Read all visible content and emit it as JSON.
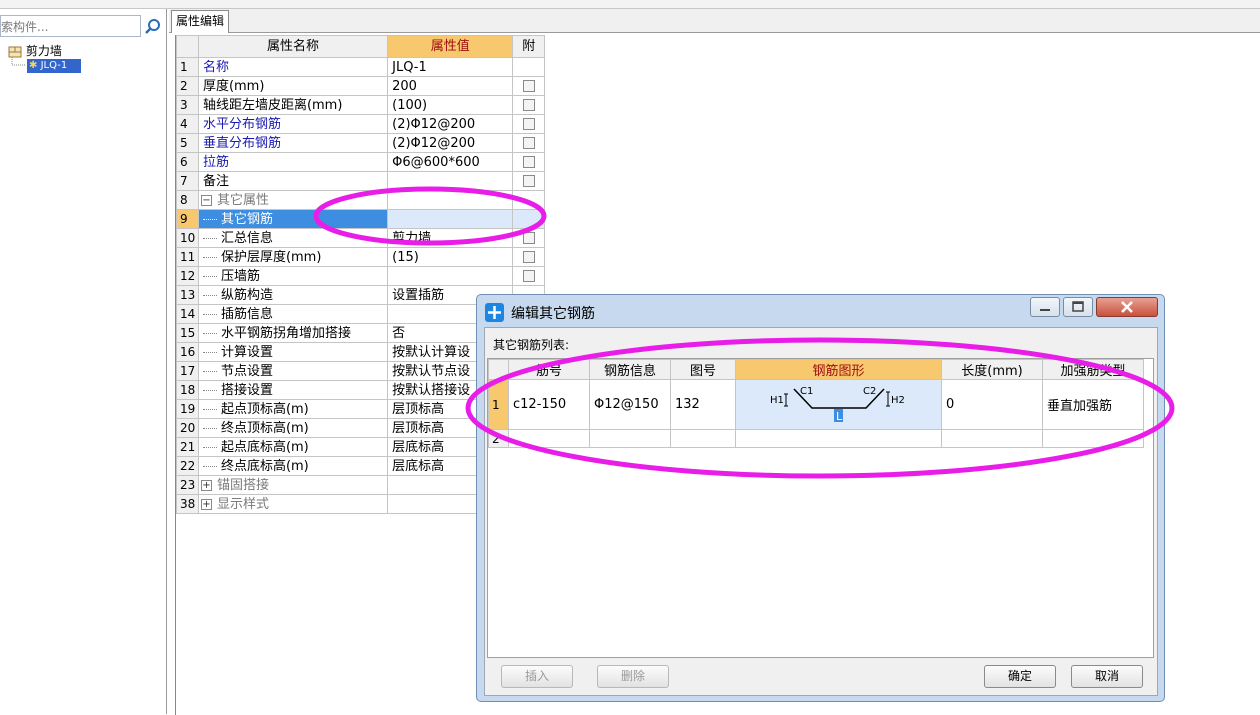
{
  "left_panel": {
    "search_text": "索构件...",
    "tree_root": "剪力墙",
    "tree_child": "JLQ-1"
  },
  "tab": {
    "label": "属性编辑"
  },
  "property_table": {
    "headers": {
      "name": "属性名称",
      "value": "属性值",
      "attached": "附"
    },
    "rows": [
      {
        "num": "1",
        "name": "名称",
        "value": "JLQ-1"
      },
      {
        "num": "2",
        "name": "厚度(mm)",
        "value": "200"
      },
      {
        "num": "3",
        "name": "轴线距左墙皮距离(mm)",
        "value": "(100)"
      },
      {
        "num": "4",
        "name": "水平分布钢筋",
        "value": "(2)Φ12@200"
      },
      {
        "num": "5",
        "name": "垂直分布钢筋",
        "value": "(2)Φ12@200"
      },
      {
        "num": "6",
        "name": "拉筋",
        "value": "Φ6@600*600"
      },
      {
        "num": "7",
        "name": "备注",
        "value": ""
      },
      {
        "num": "8",
        "name": "其它属性",
        "value": ""
      },
      {
        "num": "9",
        "name": "其它钢筋",
        "value": ""
      },
      {
        "num": "10",
        "name": "汇总信息",
        "value": "剪力墙"
      },
      {
        "num": "11",
        "name": "保护层厚度(mm)",
        "value": "(15)"
      },
      {
        "num": "12",
        "name": "压墙筋",
        "value": ""
      },
      {
        "num": "13",
        "name": "纵筋构造",
        "value": "设置插筋"
      },
      {
        "num": "14",
        "name": "插筋信息",
        "value": ""
      },
      {
        "num": "15",
        "name": "水平钢筋拐角增加搭接",
        "value": "否"
      },
      {
        "num": "16",
        "name": "计算设置",
        "value": "按默认计算设"
      },
      {
        "num": "17",
        "name": "节点设置",
        "value": "按默认节点设"
      },
      {
        "num": "18",
        "name": "搭接设置",
        "value": "按默认搭接设"
      },
      {
        "num": "19",
        "name": "起点顶标高(m)",
        "value": "层顶标高"
      },
      {
        "num": "20",
        "name": "终点顶标高(m)",
        "value": "层顶标高"
      },
      {
        "num": "21",
        "name": "起点底标高(m)",
        "value": "层底标高"
      },
      {
        "num": "22",
        "name": "终点底标高(m)",
        "value": "层底标高"
      },
      {
        "num": "23",
        "name": "锚固搭接",
        "value": ""
      },
      {
        "num": "38",
        "name": "显示样式",
        "value": ""
      }
    ]
  },
  "dialog": {
    "title": "编辑其它钢筋",
    "list_label": "其它钢筋列表:",
    "headers": {
      "num": "",
      "bar_no": "筋号",
      "bar_info": "钢筋信息",
      "shape_no": "图号",
      "shape": "钢筋图形",
      "length": "长度(mm)",
      "type": "加强筋类型"
    },
    "rows": [
      {
        "num": "1",
        "bar_no": "c12-150",
        "bar_info": "Φ12@150",
        "shape_no": "132",
        "length": "0",
        "type": "垂直加强筋"
      },
      {
        "num": "2",
        "bar_no": "",
        "bar_info": "",
        "shape_no": "",
        "length": "",
        "type": ""
      }
    ],
    "shape_labels": {
      "h1": "H1",
      "c1": "C1",
      "c2": "C2",
      "h2": "H2",
      "l": "L"
    },
    "buttons": {
      "insert": "插入",
      "delete": "删除",
      "ok": "确定",
      "cancel": "取消"
    }
  },
  "colors": {
    "highlight": "#e81ee8",
    "header_selected": "#f7c86d",
    "row_selected": "#3d8ee0"
  }
}
